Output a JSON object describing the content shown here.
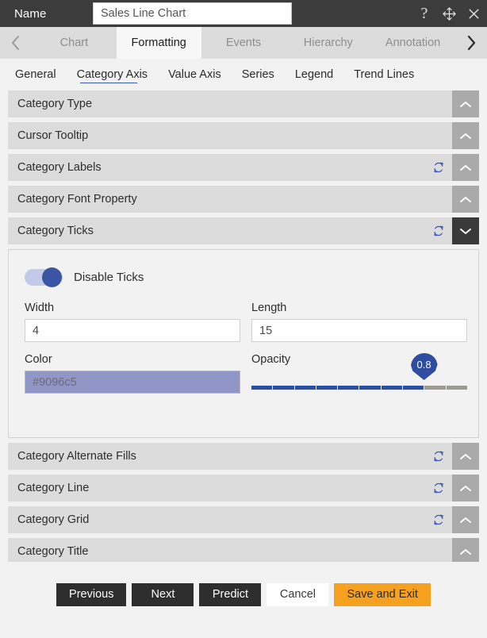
{
  "titlebar": {
    "name_label": "Name",
    "name_value": "Sales Line Chart",
    "name_placeholder": "Name",
    "help_icon": "question-mark-icon",
    "move_icon": "move-arrows-icon",
    "close_icon": "close-x-icon"
  },
  "tabbar": {
    "prev_arrow": "chevron-left-icon",
    "next_arrow": "chevron-right-icon",
    "tabs": [
      {
        "label": "Chart",
        "active": false
      },
      {
        "label": "Formatting",
        "active": true
      },
      {
        "label": "Events",
        "active": false
      },
      {
        "label": "Hierarchy",
        "active": false
      },
      {
        "label": "Annotation",
        "active": false
      }
    ]
  },
  "subtabs": [
    {
      "label": "General",
      "active": false
    },
    {
      "label": "Category Axis",
      "active": true
    },
    {
      "label": "Value Axis",
      "active": false
    },
    {
      "label": "Series",
      "active": false
    },
    {
      "label": "Legend",
      "active": false
    },
    {
      "label": "Trend Lines",
      "active": false
    }
  ],
  "accordion_top": [
    {
      "label": "Category Type",
      "refresh": false,
      "expanded": false
    },
    {
      "label": "Cursor Tooltip",
      "refresh": false,
      "expanded": false
    },
    {
      "label": "Category Labels",
      "refresh": true,
      "expanded": false
    },
    {
      "label": "Category Font Property",
      "refresh": false,
      "expanded": false
    },
    {
      "label": "Category Ticks",
      "refresh": true,
      "expanded": true
    }
  ],
  "expanded_section": {
    "title": "Category Ticks",
    "toggle": {
      "label": "Disable Ticks",
      "on": true
    },
    "width": {
      "label": "Width",
      "value": "4"
    },
    "length": {
      "label": "Length",
      "value": "15"
    },
    "color": {
      "label": "Color",
      "value": "#9096c5",
      "swatch": "#9096c5"
    },
    "opacity": {
      "label": "Opacity",
      "value": "0.8",
      "min": 0,
      "max": 1,
      "segments": 10,
      "filled": 8
    }
  },
  "accordion_bottom": [
    {
      "label": "Category Alternate Fills",
      "refresh": true,
      "expanded": false
    },
    {
      "label": "Category Line",
      "refresh": true,
      "expanded": false
    },
    {
      "label": "Category Grid",
      "refresh": true,
      "expanded": false
    },
    {
      "label": "Category Title",
      "refresh": false,
      "expanded": false
    }
  ],
  "footer_buttons": [
    {
      "label": "Previous",
      "style": "dark"
    },
    {
      "label": "Next",
      "style": "dark"
    },
    {
      "label": "Predict",
      "style": "dark"
    },
    {
      "label": "Cancel",
      "style": "light"
    },
    {
      "label": "Save and Exit",
      "style": "accent"
    }
  ],
  "colors": {
    "titlebar_bg": "#3c3c3c",
    "tab_active_bg": "#f7f7f7",
    "accent_orange": "#f5a01e",
    "accent_blue": "#2f4da0",
    "accordion_bg": "#dcdcdc",
    "toggle_btn_bg": "#aaaaaa",
    "toggle_btn_expanded_bg": "#3a3a3a"
  }
}
